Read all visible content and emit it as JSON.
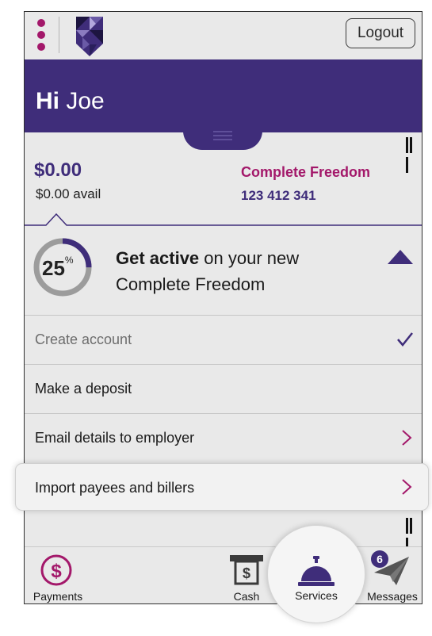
{
  "header": {
    "logout_label": "Logout"
  },
  "banner": {
    "greeting_prefix": "Hi",
    "user_name": "Joe"
  },
  "account": {
    "balance": "$0.00",
    "available": "$0.00 avail",
    "product_name": "Complete Freedom",
    "account_number": "123 412 341"
  },
  "progress": {
    "percent": "25",
    "percent_symbol": "%",
    "percent_value": 25,
    "title_bold": "Get active",
    "title_rest": " on your new Complete Freedom"
  },
  "tasks": [
    {
      "label": "Create account",
      "status": "done"
    },
    {
      "label": "Make a deposit",
      "status": "todo"
    },
    {
      "label": "Email details to employer",
      "status": "todo"
    },
    {
      "label": "Import payees and billers",
      "status": "highlighted"
    }
  ],
  "tabs": {
    "payments": "Payments",
    "cash": "Cash",
    "services": "Services",
    "messages": "Messages",
    "messages_badge": "6"
  },
  "colors": {
    "brand_purple": "#3f2d7a",
    "brand_magenta": "#a3186a"
  }
}
